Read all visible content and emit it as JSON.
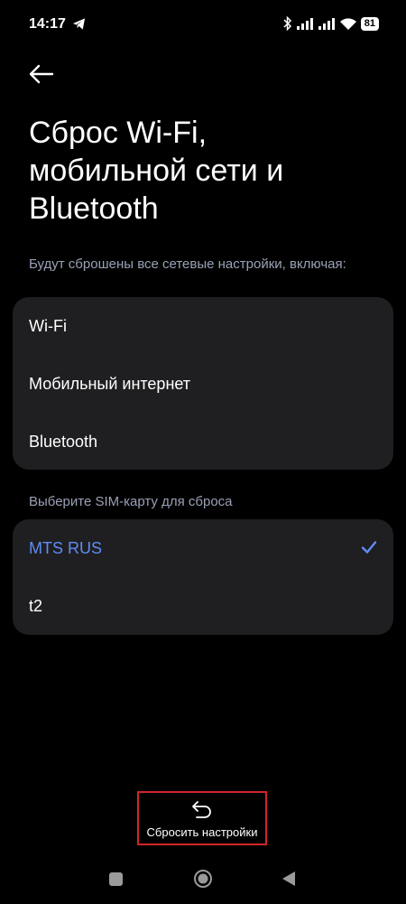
{
  "status_bar": {
    "time": "14:17",
    "battery": "81"
  },
  "header": {
    "title": "Сброс Wi-Fi, мобильной сети и Bluetooth"
  },
  "reset_info": {
    "label": "Будут сброшены все сетевые настройки, включая:",
    "items": [
      {
        "label": "Wi-Fi"
      },
      {
        "label": "Мобильный интернет"
      },
      {
        "label": "Bluetooth"
      }
    ]
  },
  "sim_selection": {
    "label": "Выберите SIM-карту для сброса",
    "options": [
      {
        "label": "MTS RUS",
        "selected": true
      },
      {
        "label": "t2",
        "selected": false
      }
    ],
    "accent_color": "#5f8cf5"
  },
  "action": {
    "reset_label": "Сбросить настройки",
    "highlight_color": "#d0262a"
  },
  "icons": {
    "back": "arrow-left-icon",
    "reset": "undo-arrow-icon",
    "check": "check-icon"
  }
}
